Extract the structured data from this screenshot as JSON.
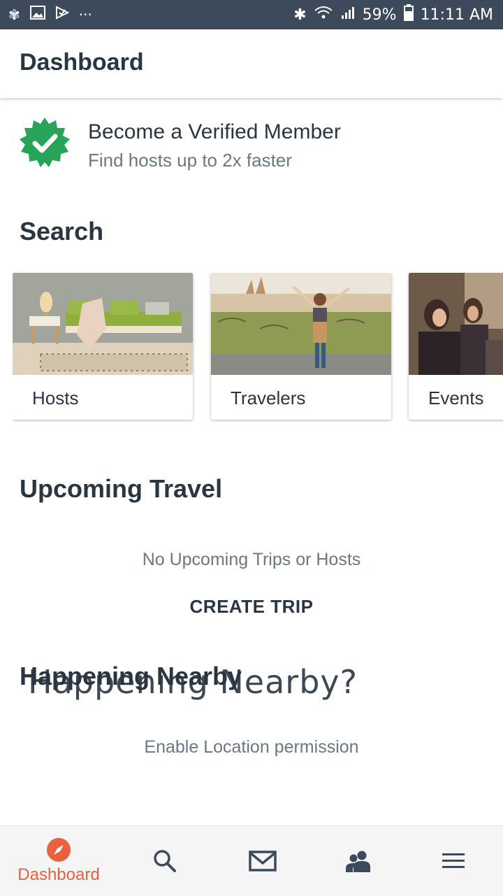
{
  "status_bar": {
    "battery": "59%",
    "time": "11:11 AM",
    "left_icons": [
      "pinwheel-icon",
      "image-icon",
      "check-app-icon",
      "more-dots-icon"
    ],
    "right_icons": [
      "bluetooth-icon",
      "wifi-icon",
      "signal-icon",
      "battery-icon"
    ]
  },
  "header": {
    "title": "Dashboard"
  },
  "verify": {
    "title": "Become a Verified Member",
    "subtitle": "Find hosts up to 2x faster",
    "badge_color": "#27a35a"
  },
  "search": {
    "title": "Search",
    "cards": [
      {
        "label": "Hosts"
      },
      {
        "label": "Travelers"
      },
      {
        "label": "Events"
      }
    ]
  },
  "upcoming": {
    "title": "Upcoming Travel",
    "empty_text": "No Upcoming Trips or Hosts",
    "create_label": "CREATE TRIP"
  },
  "nearby": {
    "title": "Happening Nearby",
    "overlay_text": "Happening Nearby?",
    "empty_text": "Enable Location permission"
  },
  "bottom_nav": {
    "active_label": "Dashboard",
    "accent": "#e8623f",
    "icons": [
      "compass-icon",
      "search-icon",
      "mail-icon",
      "people-icon",
      "menu-icon"
    ]
  }
}
